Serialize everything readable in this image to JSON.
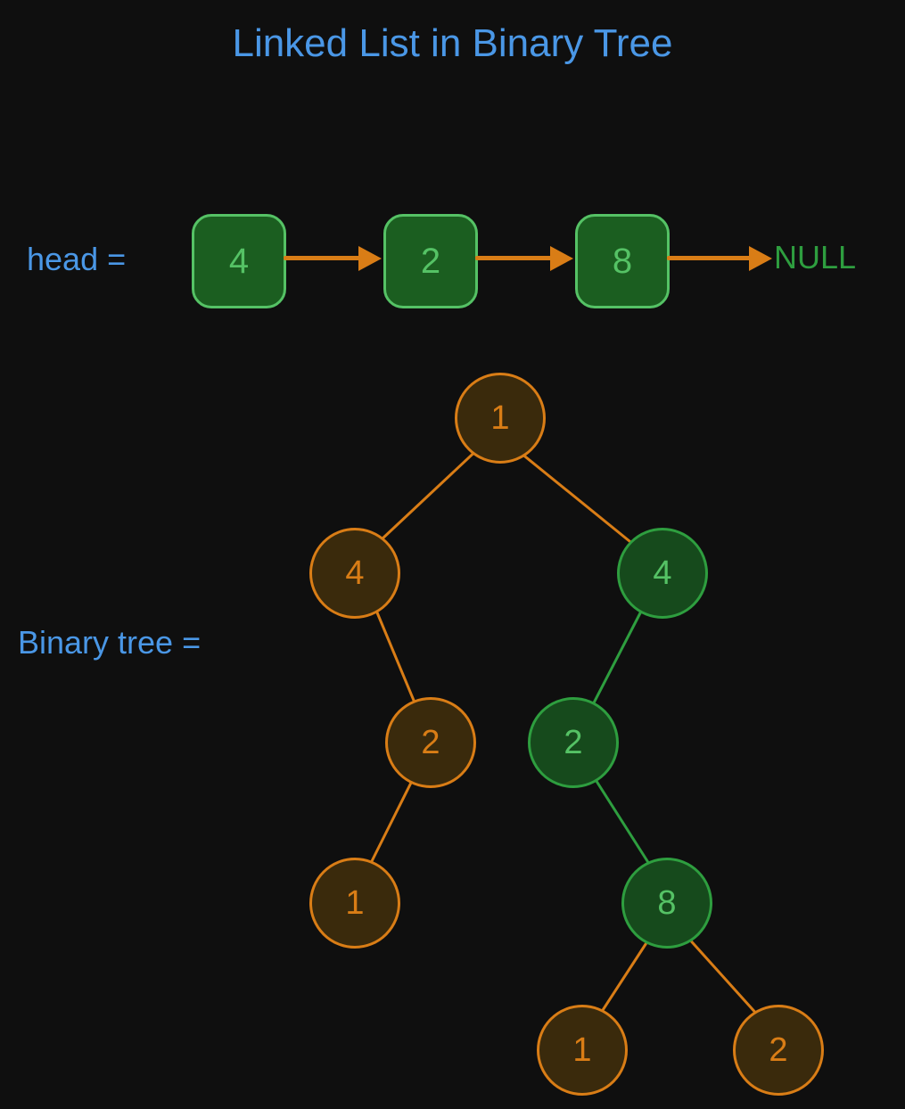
{
  "title": "Linked List in Binary Tree",
  "linked_list": {
    "head_label": "head =",
    "nodes": [
      "4",
      "2",
      "8"
    ],
    "terminal": "NULL"
  },
  "binary_tree": {
    "label": "Binary tree =",
    "nodes": {
      "root": {
        "value": "1",
        "highlighted": false
      },
      "L": {
        "value": "4",
        "highlighted": false
      },
      "R": {
        "value": "4",
        "highlighted": true
      },
      "LR": {
        "value": "2",
        "highlighted": false
      },
      "RL": {
        "value": "2",
        "highlighted": true
      },
      "LRL": {
        "value": "1",
        "highlighted": false
      },
      "RLR": {
        "value": "8",
        "highlighted": true
      },
      "RLRL": {
        "value": "1",
        "highlighted": false
      },
      "RLRR": {
        "value": "2",
        "highlighted": false
      }
    },
    "edges": [
      {
        "from": "root",
        "to": "L",
        "highlighted": false
      },
      {
        "from": "root",
        "to": "R",
        "highlighted": false
      },
      {
        "from": "L",
        "to": "LR",
        "highlighted": false
      },
      {
        "from": "R",
        "to": "RL",
        "highlighted": true
      },
      {
        "from": "LR",
        "to": "LRL",
        "highlighted": false
      },
      {
        "from": "RL",
        "to": "RLR",
        "highlighted": true
      },
      {
        "from": "RLR",
        "to": "RLRL",
        "highlighted": false
      },
      {
        "from": "RLR",
        "to": "RLRR",
        "highlighted": false
      }
    ]
  },
  "colors": {
    "background": "#0f0f0f",
    "title_text": "#4a97e6",
    "list_node_fill": "#1b5e20",
    "list_node_border": "#55c265",
    "arrow": "#d97d16",
    "null_text": "#2e9e3f",
    "tree_node_orange_border": "#d97d16",
    "tree_node_orange_fill": "#3a2a0c",
    "tree_node_green_border": "#2e9e3f",
    "tree_node_green_fill": "#164a1c"
  },
  "chart_data": {
    "type": "diagram",
    "linked_list_values": [
      4,
      2,
      8
    ],
    "binary_tree_structure": {
      "value": 1,
      "left": {
        "value": 4,
        "right": {
          "value": 2,
          "left": {
            "value": 1
          }
        }
      },
      "right": {
        "value": 4,
        "highlighted": true,
        "left": {
          "value": 2,
          "highlighted": true,
          "right": {
            "value": 8,
            "highlighted": true,
            "left": {
              "value": 1
            },
            "right": {
              "value": 2
            }
          }
        }
      }
    },
    "highlighted_path_values": [
      4,
      2,
      8
    ]
  }
}
